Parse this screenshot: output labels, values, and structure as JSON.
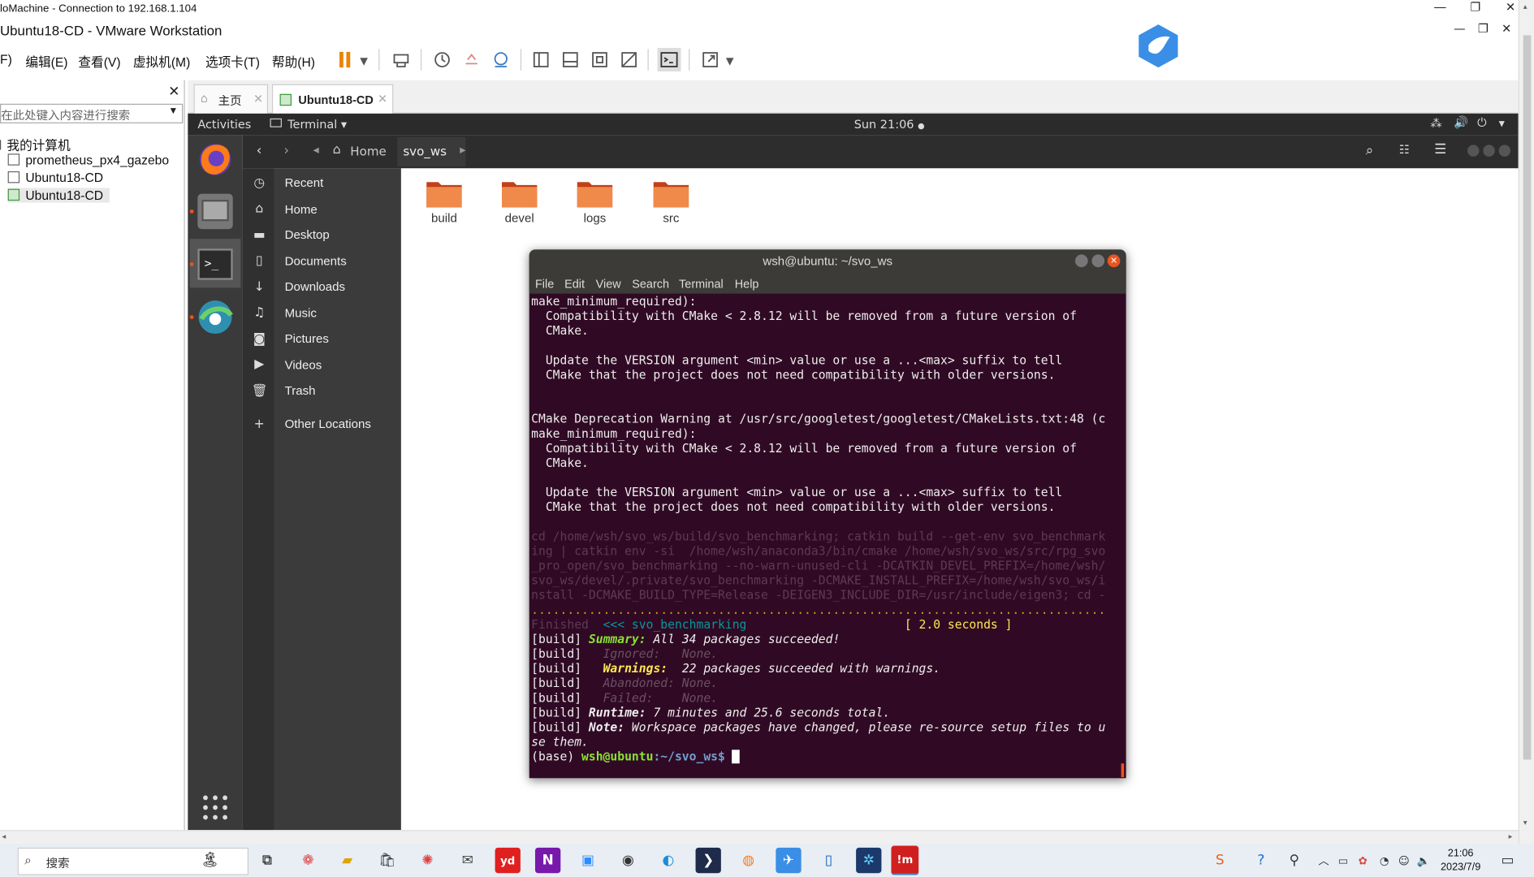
{
  "nomachine_title": "loMachine - Connection to 192.168.1.104",
  "vmware_title": "Ubuntu18-CD - VMware Workstation",
  "menu": [
    "F)",
    "编辑(E)",
    "查看(V)",
    "虚拟机(M)",
    "选项卡(T)",
    "帮助(H)"
  ],
  "library": {
    "search_placeholder": "在此处键入内容进行搜索",
    "root": "我的计算机",
    "items": [
      "prometheus_px4_gazebo",
      "Ubuntu18-CD",
      "Ubuntu18-CD"
    ]
  },
  "tabs": [
    {
      "label": "主页"
    },
    {
      "label": "Ubuntu18-CD"
    }
  ],
  "ubuntu": {
    "activities": "Activities",
    "app_menu": "Terminal",
    "clock": "Sun 21:06"
  },
  "files": {
    "breadcrumb": [
      "Home",
      "svo_ws"
    ],
    "sidebar": [
      "Recent",
      "Home",
      "Desktop",
      "Documents",
      "Downloads",
      "Music",
      "Pictures",
      "Videos",
      "Trash",
      "Other Locations"
    ],
    "folders": [
      "build",
      "devel",
      "logs",
      "src"
    ]
  },
  "terminal": {
    "title": "wsh@ubuntu: ~/svo_ws",
    "menu": [
      "File",
      "Edit",
      "View",
      "Search",
      "Terminal",
      "Help"
    ],
    "lines_plain_1": "make_minimum_required):\n  Compatibility with CMake < 2.8.12 will be removed from a future version of\n  CMake.\n\n  Update the VERSION argument <min> value or use a ...<max> suffix to tell\n  CMake that the project does not need compatibility with older versions.\n\n\nCMake Deprecation Warning at /usr/src/googletest/googletest/CMakeLists.txt:48 (c\nmake_minimum_required):\n  Compatibility with CMake < 2.8.12 will be removed from a future version of\n  CMake.\n\n  Update the VERSION argument <min> value or use a ...<max> suffix to tell\n  CMake that the project does not need compatibility with older versions.\n\n",
    "lines_dim": "cd /home/wsh/svo_ws/build/svo_benchmarking; catkin build --get-env svo_benchmark\ning | catkin env -si  /home/wsh/anaconda3/bin/cmake /home/wsh/svo_ws/src/rpg_svo\n_pro_open/svo_benchmarking --no-warn-unused-cli -DCATKIN_DEVEL_PREFIX=/home/wsh/\nsvo_ws/devel/.private/svo_benchmarking -DCMAKE_INSTALL_PREFIX=/home/wsh/svo_ws/i\nnstall -DCMAKE_BUILD_TYPE=Release -DEIGEN3_INCLUDE_DIR=/usr/include/eigen3; cd -",
    "dots": "................................................................................",
    "finished_label": "Finished",
    "finished_arrow": "<<<",
    "finished_pkg": "svo_benchmarking",
    "finished_time": "[ 2.0 seconds ]",
    "build_prefix": "[build]",
    "summary_label": "Summary:",
    "summary_text": "All 34 packages succeeded!",
    "ignored_label": "Ignored:",
    "ignored_val": "None.",
    "warnings_label": "Warnings:",
    "warnings_text": "22 packages succeeded with warnings.",
    "abandoned_label": "Abandoned:",
    "abandoned_val": "None.",
    "failed_label": "Failed:",
    "failed_val": "None.",
    "runtime_label": "Runtime:",
    "runtime_text": "7 minutes and 25.6 seconds total.",
    "note_label": "Note:",
    "note_text": "Workspace packages have changed, please re-source setup files to u\nse them.",
    "prompt_env": "(base)",
    "prompt_user": "wsh@ubuntu",
    "prompt_path": ":~/svo_ws$"
  },
  "taskbar": {
    "search": "搜索",
    "time": "21:06",
    "date": "2023/7/9"
  },
  "colors": {
    "terminal_bg": "#300a24",
    "ubuntu_orange": "#e95420",
    "green": "#8ae234",
    "yellow": "#fce94f"
  }
}
